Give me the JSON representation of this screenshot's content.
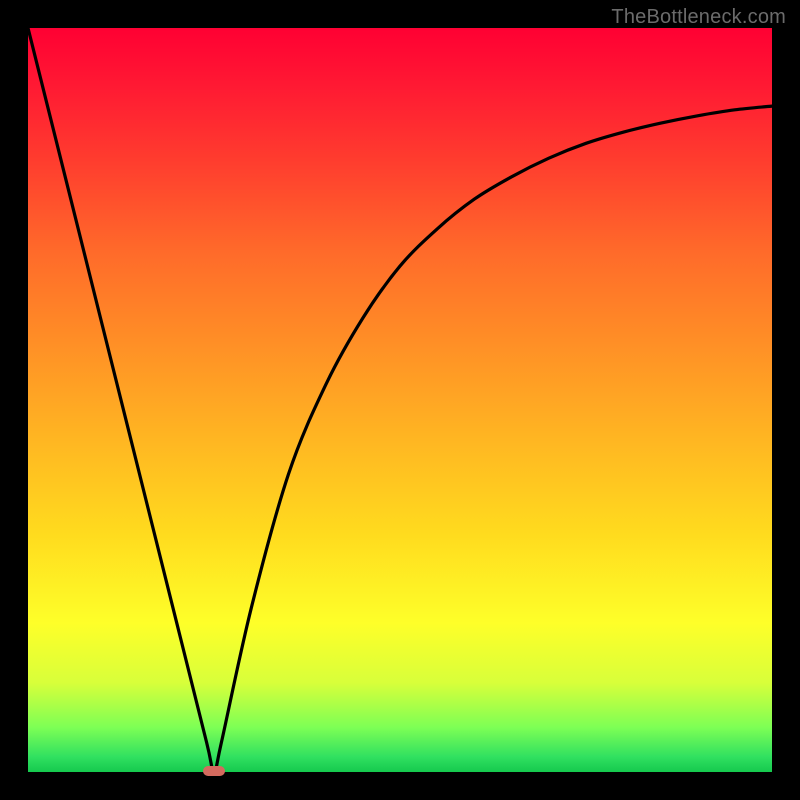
{
  "watermark": "TheBottleneck.com",
  "colors": {
    "background": "#000000",
    "curve": "#000000",
    "marker": "#d46a5e"
  },
  "chart_data": {
    "type": "line",
    "title": "",
    "xlabel": "",
    "ylabel": "",
    "xlim": [
      0,
      100
    ],
    "ylim": [
      0,
      100
    ],
    "grid": false,
    "series": [
      {
        "name": "bottleneck-curve",
        "x": [
          0,
          5,
          10,
          15,
          20,
          24,
          25,
          26,
          30,
          35,
          40,
          45,
          50,
          55,
          60,
          65,
          70,
          75,
          80,
          85,
          90,
          95,
          100
        ],
        "values": [
          100,
          80,
          60,
          40,
          20,
          4,
          0,
          4,
          22,
          40,
          52,
          61,
          68,
          73,
          77,
          80,
          82.5,
          84.5,
          86,
          87.2,
          88.2,
          89,
          89.5
        ]
      }
    ],
    "annotations": [
      {
        "name": "optimal-marker",
        "x": 25,
        "y": 0
      }
    ],
    "background_gradient": {
      "orientation": "vertical",
      "stops": [
        {
          "pos": 0.0,
          "color": "#ff0033"
        },
        {
          "pos": 0.3,
          "color": "#ff6a2a"
        },
        {
          "pos": 0.55,
          "color": "#ffb522"
        },
        {
          "pos": 0.8,
          "color": "#feff29"
        },
        {
          "pos": 0.94,
          "color": "#7dff55"
        },
        {
          "pos": 1.0,
          "color": "#15c94e"
        }
      ]
    }
  }
}
